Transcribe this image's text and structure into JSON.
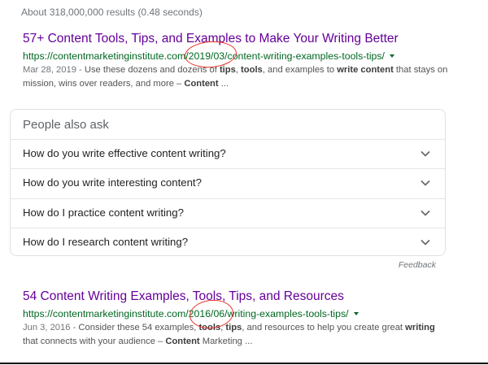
{
  "search": {
    "stats": "About 318,000,000 results (0.48 seconds)"
  },
  "results": [
    {
      "title": "57+ Content Tools, Tips, and Examples to Make Your Writing Better",
      "url": "https://contentmarketinginstitute.com/2019/03/content-writing-examples-tools-tips/",
      "snippet_date": "Mar 28, 2019 - ",
      "snippet_line1_a": "Use these dozens and dozens of ",
      "snippet_line1_b": "tips",
      "snippet_line1_c": ", ",
      "snippet_line1_d": "tools",
      "snippet_line1_e": ", and examples to ",
      "snippet_line1_f": "write content",
      "snippet_line1_g": " that stays on",
      "snippet_line2_a": "mission, wins over readers, and more – ",
      "snippet_line2_b": "Content",
      "snippet_line2_c": " ..."
    },
    {
      "title": "54 Content Writing Examples, Tools, Tips, and Resources",
      "url": "https://contentmarketinginstitute.com/2016/06/writing-examples-tools-tips/",
      "snippet_date": "Jun 3, 2016 - ",
      "snippet_line1_a": "Consider these 54 examples, ",
      "snippet_line1_b": "tools",
      "snippet_line1_c": ", ",
      "snippet_line1_d": "tips",
      "snippet_line1_e": ", and resources to help you create great ",
      "snippet_line1_f": "writing",
      "snippet_line2_a": "that connects with your audience – ",
      "snippet_line2_b": "Content",
      "snippet_line2_c": " Marketing ..."
    }
  ],
  "people_also_ask": {
    "heading": "People also ask",
    "questions": [
      "How do you write effective content writing?",
      "How do you write interesting content?",
      "How do I practice content writing?",
      "How do I research content writing?"
    ],
    "feedback": "Feedback"
  },
  "colors": {
    "visited_title": "#660099",
    "url_green": "#006621",
    "annotation_red": "#e8322a"
  }
}
